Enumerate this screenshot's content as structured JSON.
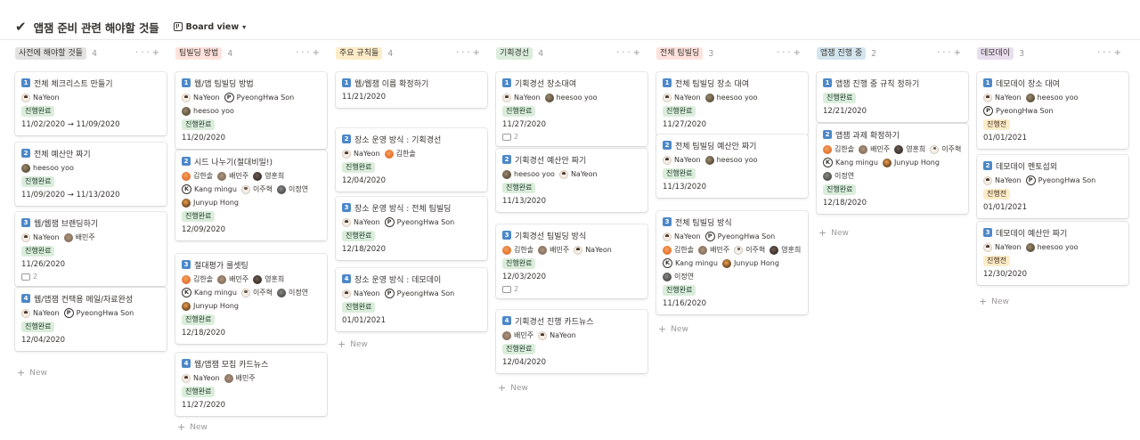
{
  "page": {
    "check_icon": "✔",
    "title": "앱잼 준비 관련 해야할 것들",
    "view_label": "Board view"
  },
  "colors": {
    "done_bg": "#dbeddb",
    "todo_bg": "#fdecc8",
    "num_badge": "#4c88c8"
  },
  "new_label": "New",
  "columns": [
    {
      "name": "사전에 해야할 것들",
      "count": "4",
      "color": "#e3e2e0",
      "cards": [
        {
          "num": "1",
          "title": "전체 체크리스트 만들기",
          "people": [
            {
              "n": "NaYeon",
              "av": "nay"
            }
          ],
          "tag": "진행완료",
          "date": "11/02/2020 → 11/09/2020"
        },
        {
          "num": "2",
          "title": "전체 예산안 짜기",
          "people": [
            {
              "n": "heesoo yoo",
              "av": "photo1"
            }
          ],
          "tag": "진행완료",
          "date": "11/09/2020 → 11/13/2020"
        },
        {
          "num": "3",
          "title": "웹/웹잼 브랜딩하기",
          "people": [
            {
              "n": "NaYeon",
              "av": "nay"
            },
            {
              "n": "배민주",
              "av": "photo2"
            }
          ],
          "tag": "진행완료",
          "date": "11/26/2020",
          "comments": "2"
        },
        {
          "num": "4",
          "title": "웹/앱잼 컨택용 메일/자료완성",
          "people": [
            {
              "n": "NaYeon",
              "av": "nay"
            },
            {
              "n": "PyeongHwa Son",
              "av": "p"
            }
          ],
          "tag": "진행완료",
          "date": "12/04/2020"
        }
      ]
    },
    {
      "name": "팀빌딩 방법",
      "count": "4",
      "color": "#ffe2dd",
      "cards": [
        {
          "num": "1",
          "title": "웹/앱 팀빌딩 방법",
          "people": [
            {
              "n": "NaYeon",
              "av": "nay"
            },
            {
              "n": "PyeongHwa Son",
              "av": "p"
            },
            {
              "n": "heesoo yoo",
              "av": "photo1"
            }
          ],
          "tag": "진행완료",
          "date": "11/20/2020"
        },
        {
          "num": "2",
          "title": "시드 나누기(절대비밀!)",
          "people": [
            {
              "n": "김한솔",
              "av": "orange"
            },
            {
              "n": "배민주",
              "av": "photo2"
            },
            {
              "n": "영훈희",
              "av": "dark"
            },
            {
              "n": "Kang mingu",
              "av": "k"
            },
            {
              "n": "이주혁",
              "av": "ljh"
            },
            {
              "n": "이정연",
              "av": "gray"
            },
            {
              "n": "Junyup Hong",
              "av": "jh"
            }
          ],
          "tag": "진행완료",
          "date": "12/09/2020"
        },
        {
          "num": "3",
          "title": "절대평가 룰셋팅",
          "people": [
            {
              "n": "김한솔",
              "av": "orange"
            },
            {
              "n": "배민주",
              "av": "photo2"
            },
            {
              "n": "영훈희",
              "av": "dark"
            },
            {
              "n": "Kang mingu",
              "av": "k"
            },
            {
              "n": "이주혁",
              "av": "ljh"
            },
            {
              "n": "이정연",
              "av": "gray"
            },
            {
              "n": "Junyup Hong",
              "av": "jh"
            }
          ],
          "tag": "진행완료",
          "date": "12/18/2020"
        },
        {
          "num": "4",
          "title": "웹/앱잼 모집 카드뉴스",
          "people": [
            {
              "n": "NaYeon",
              "av": "nay"
            },
            {
              "n": "배민주",
              "av": "photo2"
            }
          ],
          "tag": "진행완료",
          "date": "11/27/2020"
        }
      ]
    },
    {
      "name": "주요 규칙들",
      "count": "4",
      "color": "#fdecc8",
      "cards": [
        {
          "num": "1",
          "title": "웹/웹잼 이름 확정하기",
          "people": [],
          "tag": "",
          "date": "11/21/2020"
        },
        {
          "num": "2",
          "title": "장소 운영 방식 : 기획경선",
          "people": [
            {
              "n": "NaYeon",
              "av": "nay"
            },
            {
              "n": "김한솔",
              "av": "orange"
            }
          ],
          "tag": "진행완료",
          "date": "12/04/2020"
        },
        {
          "num": "3",
          "title": "장소 운영 방식 : 전체 팀빌딩",
          "people": [
            {
              "n": "NaYeon",
              "av": "nay"
            },
            {
              "n": "PyeongHwa Son",
              "av": "p"
            }
          ],
          "tag": "진행완료",
          "date": "12/18/2020"
        },
        {
          "num": "4",
          "title": "장소 운영 방식 : 데모데이",
          "people": [
            {
              "n": "NaYeon",
              "av": "nay"
            },
            {
              "n": "PyeongHwa Son",
              "av": "p"
            }
          ],
          "tag": "진행완료",
          "date": "01/01/2021"
        }
      ]
    },
    {
      "name": "기획경선",
      "count": "4",
      "color": "#dbeddb",
      "cards": [
        {
          "num": "1",
          "title": "기획경선 장소대여",
          "people": [
            {
              "n": "NaYeon",
              "av": "nay"
            },
            {
              "n": "heesoo yoo",
              "av": "photo1"
            }
          ],
          "tag": "진행완료",
          "date": "11/27/2020",
          "comments": "2"
        },
        {
          "num": "2",
          "title": "기획경선 예산안 짜기",
          "people": [
            {
              "n": "heesoo yoo",
              "av": "photo1"
            },
            {
              "n": "NaYeon",
              "av": "nay"
            }
          ],
          "tag": "진행완료",
          "date": "11/13/2020"
        },
        {
          "num": "3",
          "title": "기획경선 팀빌딩 방식",
          "people": [
            {
              "n": "김한솔",
              "av": "orange"
            },
            {
              "n": "배민주",
              "av": "photo2"
            },
            {
              "n": "NaYeon",
              "av": "nay"
            }
          ],
          "tag": "진행완료",
          "date": "12/03/2020",
          "comments": "2"
        },
        {
          "num": "4",
          "title": "기획경선 진행 카드뉴스",
          "people": [
            {
              "n": "배민주",
              "av": "photo2"
            },
            {
              "n": "NaYeon",
              "av": "nay"
            }
          ],
          "tag": "진행완료",
          "date": "12/04/2020"
        }
      ]
    },
    {
      "name": "전체 팀빌딩",
      "count": "3",
      "color": "#ffe2dd",
      "cards": [
        {
          "num": "1",
          "title": "전체 팀빌딩 장소 대여",
          "people": [
            {
              "n": "NaYeon",
              "av": "nay"
            },
            {
              "n": "heesoo yoo",
              "av": "photo1"
            }
          ],
          "tag": "진행완료",
          "date": "11/27/2020"
        },
        {
          "num": "2",
          "title": "전체 팀빌딩 예산안 짜기",
          "people": [
            {
              "n": "NaYeon",
              "av": "nay"
            },
            {
              "n": "heesoo yoo",
              "av": "photo1"
            }
          ],
          "tag": "진행완료",
          "date": "11/13/2020"
        },
        {
          "num": "3",
          "title": "전체 팀빌딩 방식",
          "people": [
            {
              "n": "NaYeon",
              "av": "nay"
            },
            {
              "n": "PyeongHwa Son",
              "av": "p"
            },
            {
              "n": "김한솔",
              "av": "orange"
            },
            {
              "n": "배민주",
              "av": "photo2"
            },
            {
              "n": "이주혁",
              "av": "ljh"
            },
            {
              "n": "영훈희",
              "av": "dark"
            },
            {
              "n": "Kang mingu",
              "av": "k"
            },
            {
              "n": "Junyup Hong",
              "av": "jh"
            },
            {
              "n": "이정연",
              "av": "gray"
            }
          ],
          "tag": "진행완료",
          "date": "11/16/2020"
        }
      ]
    },
    {
      "name": "앱잼 진행 중",
      "count": "2",
      "color": "#d3e5ef",
      "cards": [
        {
          "num": "1",
          "title": "앱잼 진행 중 규칙 정하기",
          "people": [],
          "tag": "진행완료",
          "date": "12/21/2020"
        },
        {
          "num": "2",
          "title": "앱잼 과제 확정하기",
          "people": [
            {
              "n": "김한솔",
              "av": "orange"
            },
            {
              "n": "배민주",
              "av": "photo2"
            },
            {
              "n": "영훈희",
              "av": "dark"
            },
            {
              "n": "이주혁",
              "av": "ljh"
            },
            {
              "n": "Kang mingu",
              "av": "k"
            },
            {
              "n": "Junyup Hong",
              "av": "jh"
            },
            {
              "n": "이정연",
              "av": "gray"
            }
          ],
          "tag": "진행완료",
          "date": "12/18/2020"
        }
      ]
    },
    {
      "name": "데모데이",
      "count": "3",
      "color": "#e8deee",
      "cards": [
        {
          "num": "1",
          "title": "데모데이 장소 대여",
          "people": [
            {
              "n": "NaYeon",
              "av": "nay"
            },
            {
              "n": "heesoo yoo",
              "av": "photo1"
            },
            {
              "n": "PyeongHwa Son",
              "av": "p"
            }
          ],
          "tag": "진행전",
          "date": "01/01/2021"
        },
        {
          "num": "2",
          "title": "데모데이 멘토섭외",
          "people": [
            {
              "n": "NaYeon",
              "av": "nay"
            },
            {
              "n": "PyeongHwa Son",
              "av": "p"
            }
          ],
          "tag": "진행전",
          "date": "01/01/2021"
        },
        {
          "num": "3",
          "title": "데모데이 예산안 짜기",
          "people": [
            {
              "n": "NaYeon",
              "av": "nay"
            },
            {
              "n": "heesoo yoo",
              "av": "photo1"
            }
          ],
          "tag": "진행전",
          "date": "12/30/2020"
        }
      ]
    }
  ]
}
